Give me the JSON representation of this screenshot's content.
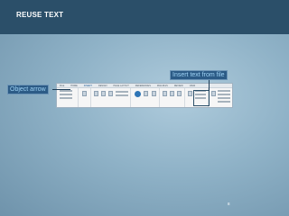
{
  "slide": {
    "title": "REUSE TEXT",
    "page_number": "8"
  },
  "callouts": {
    "object_arrow": "Object arrow",
    "insert_text": "Insert text from file"
  },
  "ribbon": {
    "tabs": [
      {
        "label": "FILE"
      },
      {
        "label": "HOME"
      },
      {
        "label": "INSERT"
      },
      {
        "label": "DESIGN"
      },
      {
        "label": "PAGE LAYOUT"
      },
      {
        "label": "REFERENCES"
      },
      {
        "label": "MAILINGS"
      },
      {
        "label": "REVIEW"
      },
      {
        "label": "VIEW"
      }
    ]
  },
  "colors": {
    "title_bar": "#2b4f69",
    "callout_bg": "#2c5b86",
    "callout_text": "#9fd3f5",
    "background": "#8fb2c7"
  }
}
